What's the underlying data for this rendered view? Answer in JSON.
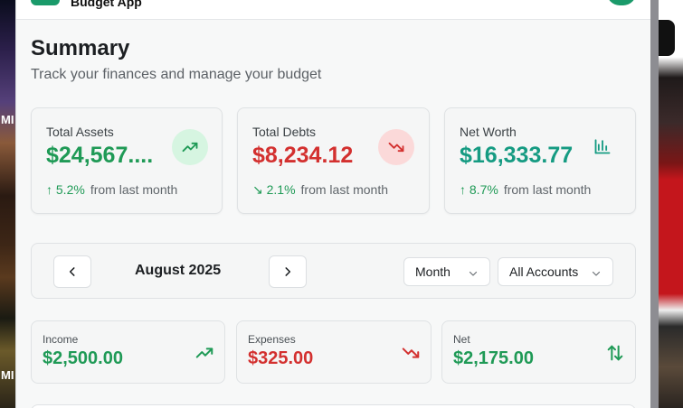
{
  "background": {
    "left_labels": [
      "MI",
      "MI"
    ]
  },
  "header": {
    "app_name": "Budget App"
  },
  "page": {
    "title": "Summary",
    "subtitle": "Track your finances and manage your budget"
  },
  "summary_cards": [
    {
      "label": "Total Assets",
      "value": "$24,567....",
      "change": "5.2%",
      "change_text": "from last month",
      "icon": "trending-up-icon",
      "color": "#1f9a56"
    },
    {
      "label": "Total Debts",
      "value": "$8,234.12",
      "change": "2.1%",
      "change_text": "from last month",
      "icon": "trending-down-icon",
      "color": "#d3302f"
    },
    {
      "label": "Net Worth",
      "value": "$16,333.77",
      "change": "8.7%",
      "change_text": "from last month",
      "icon": "bar-chart-icon",
      "color": "#159b82"
    }
  ],
  "period": {
    "label": "August 2025",
    "view_select": "Month",
    "account_select": "All Accounts"
  },
  "monthly": [
    {
      "label": "Income",
      "value": "$2,500.00",
      "icon": "trending-up-icon",
      "color": "#1f9a56"
    },
    {
      "label": "Expenses",
      "value": "$325.00",
      "icon": "trending-down-icon",
      "color": "#d3302f"
    },
    {
      "label": "Net",
      "value": "$2,175.00",
      "icon": "arrows-up-down-icon",
      "color": "#1f9a56"
    }
  ]
}
